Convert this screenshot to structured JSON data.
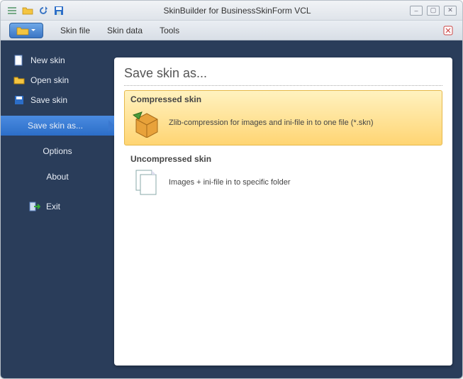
{
  "title": "SkinBuilder for BusinessSkinForm VCL",
  "menubar": {
    "items": [
      "Skin file",
      "Skin data",
      "Tools"
    ]
  },
  "sidebar": {
    "items": [
      {
        "label": "New skin"
      },
      {
        "label": "Open skin"
      },
      {
        "label": "Save skin"
      },
      {
        "label": "Save skin as...",
        "selected": true
      },
      {
        "label": "Options",
        "noicon": true
      },
      {
        "label": "About",
        "noicon": true
      },
      {
        "label": "Exit"
      }
    ]
  },
  "panel": {
    "title": "Save skin as...",
    "option1": {
      "header": "Compressed skin",
      "desc": "Zlib-compression for images and ini-file in to one file (*.skn)"
    },
    "option2": {
      "header": "Uncompressed skin",
      "desc": "Images + ini-file in to specific folder"
    }
  }
}
